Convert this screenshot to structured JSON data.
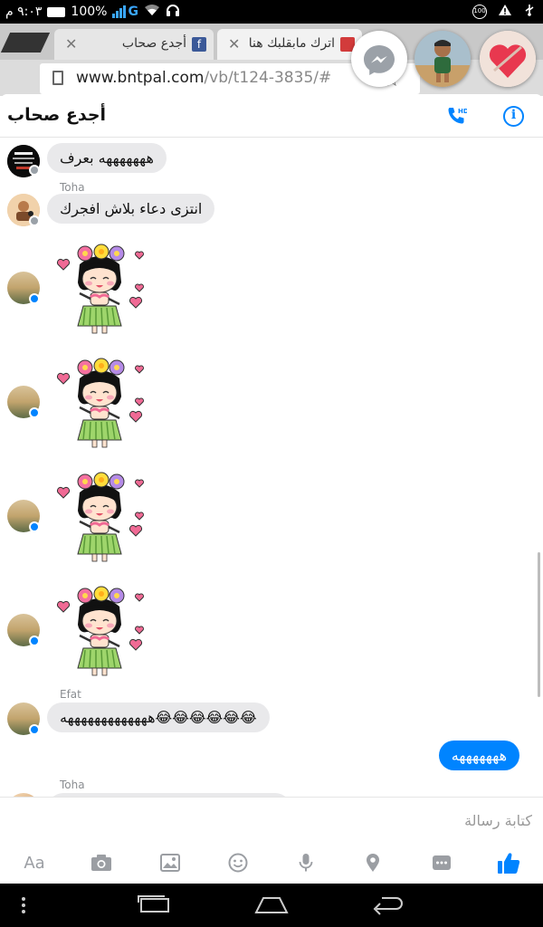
{
  "status_bar": {
    "time": "٩:٠٣ م",
    "battery": "100%",
    "network": "G",
    "notification_count": "100"
  },
  "browser": {
    "tabs": [
      {
        "label": "أجدع صحاب",
        "favicon": "f"
      },
      {
        "label": "اترك مابقلبك هنا",
        "favicon": ""
      }
    ],
    "url_host": "www.bntpal.com",
    "url_path": "/vb/t124-3835/#"
  },
  "chat_heads": [
    "messenger-icon",
    "person-avatar",
    "heart-avatar"
  ],
  "chat": {
    "title": "أجدع صحاب",
    "colors": {
      "accent": "#0084ff",
      "incoming_bubble": "#e9e9eb"
    },
    "messages": [
      {
        "sender": "",
        "text": "هههههههه بعرف"
      },
      {
        "sender": "Toha",
        "text": "انتزى دعاء بلاش افجرك"
      },
      {
        "sender": "",
        "sticker": "girl-flower-sticker"
      },
      {
        "sender": "",
        "sticker": "girl-flower-sticker"
      },
      {
        "sender": "",
        "sticker": "girl-flower-sticker"
      },
      {
        "sender": "",
        "sticker": "girl-flower-sticker"
      },
      {
        "sender": "Efat",
        "text": "هههههههههههههه😂😂😂😂😂😂"
      },
      {
        "sender": "me",
        "text": "هههههههه"
      },
      {
        "sender": "Toha",
        "text": ""
      }
    ]
  },
  "composer": {
    "placeholder": "كتابة رسالة",
    "aa_label": "Aa",
    "tools": [
      "text-format-icon",
      "camera-icon",
      "gallery-icon",
      "emoji-icon",
      "microphone-icon",
      "location-icon",
      "more-icon",
      "like-icon"
    ]
  },
  "nav": [
    "menu-icon",
    "recent-apps-icon",
    "home-icon",
    "back-icon"
  ]
}
